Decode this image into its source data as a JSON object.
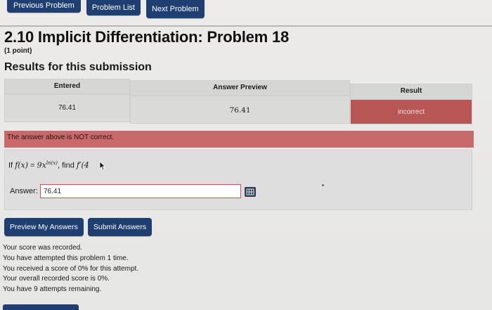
{
  "nav": {
    "previous_label": "Previous Problem",
    "list_label": "Problem List",
    "next_label": "Next Problem"
  },
  "title": "2.10 Implicit Differentiation: Problem 18",
  "points": "(1 point)",
  "results_heading": "Results for this submission",
  "results_table": {
    "headers": [
      "Entered",
      "Answer Preview",
      "Result"
    ],
    "row": {
      "entered": "76.41",
      "preview": "76.41",
      "result": "incorrect"
    }
  },
  "error_message": "The answer above is NOT correct.",
  "question": {
    "prefix": "If",
    "fx": "f(x)",
    "equals": "=",
    "expression_base": "9x",
    "exponent": "ln(x)",
    "find_text": ", find",
    "derivative": "f′(4"
  },
  "answer": {
    "label": "Answer:",
    "value": "76.41"
  },
  "actions": {
    "preview_label": "Preview My Answers",
    "submit_label": "Submit Answers"
  },
  "messages": [
    "Your score was recorded.",
    "You have attempted this problem 1 time.",
    "You received a score of 0% for this attempt.",
    "Your overall recorded score is 0%.",
    "You have 9 attempts remaining."
  ],
  "colors": {
    "button_blue": "#1f3f73",
    "incorrect_red": "#b85555",
    "error_bar": "#c9696b"
  },
  "icons": [
    "cursor-icon",
    "equation-editor-icon"
  ]
}
